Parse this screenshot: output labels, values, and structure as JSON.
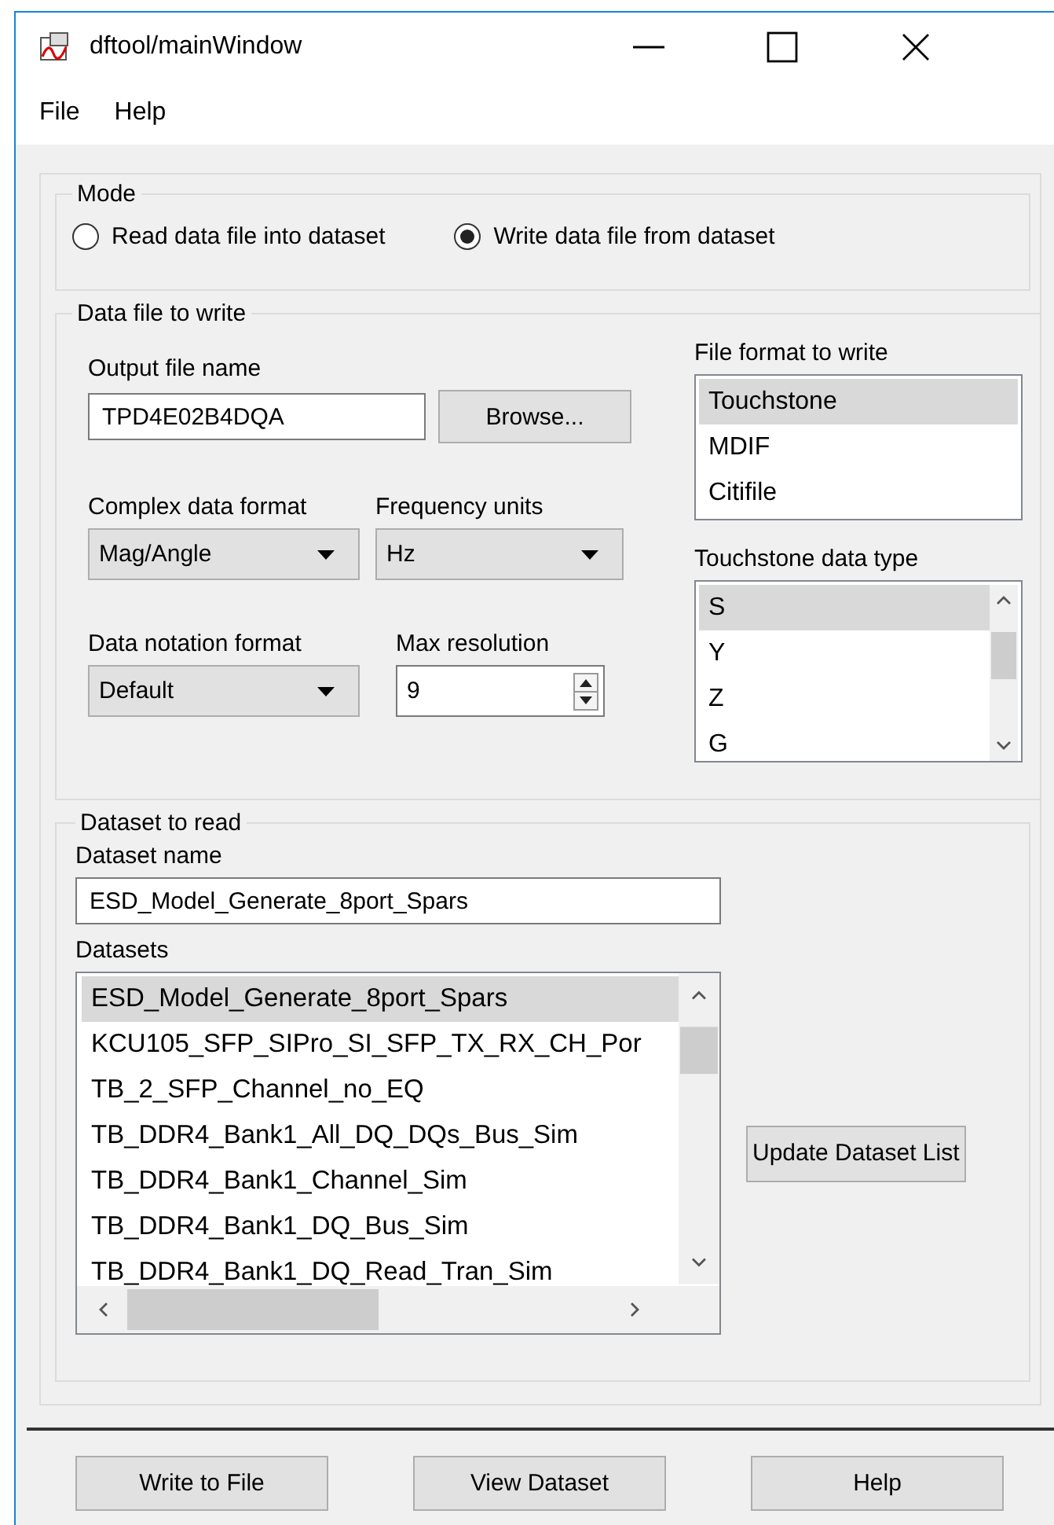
{
  "window": {
    "title": "dftool/mainWindow"
  },
  "menu": [
    {
      "label": "File"
    },
    {
      "label": "Help"
    }
  ],
  "mode": {
    "title": "Mode",
    "options": [
      {
        "label": "Read data file into dataset",
        "selected": false
      },
      {
        "label": "Write data file from dataset",
        "selected": true
      }
    ]
  },
  "data_file": {
    "title": "Data file to write",
    "output_file_name": {
      "label": "Output file name",
      "value": "TPD4E02B4DQA"
    },
    "browse_button": "Browse...",
    "complex_format": {
      "label": "Complex data format",
      "value": "Mag/Angle"
    },
    "frequency_units": {
      "label": "Frequency units",
      "value": "Hz"
    },
    "notation_format": {
      "label": "Data notation format",
      "value": "Default"
    },
    "max_resolution": {
      "label": "Max resolution",
      "value": "9"
    },
    "file_format": {
      "label": "File format to write",
      "items": [
        {
          "label": "Touchstone",
          "selected": true
        },
        {
          "label": "MDIF",
          "selected": false
        },
        {
          "label": "Citifile",
          "selected": false
        }
      ]
    },
    "touchstone_type": {
      "label": "Touchstone data type",
      "items": [
        {
          "label": "S",
          "selected": true
        },
        {
          "label": "Y",
          "selected": false
        },
        {
          "label": "Z",
          "selected": false
        },
        {
          "label": "G",
          "selected": false
        }
      ]
    }
  },
  "dataset": {
    "title": "Dataset to read",
    "name": {
      "label": "Dataset name",
      "value": "ESD_Model_Generate_8port_Spars"
    },
    "datasets": {
      "label": "Datasets",
      "items": [
        {
          "label": "ESD_Model_Generate_8port_Spars",
          "selected": true
        },
        {
          "label": "KCU105_SFP_SIPro_SI_SFP_TX_RX_CH_Por",
          "selected": false
        },
        {
          "label": "TB_2_SFP_Channel_no_EQ",
          "selected": false
        },
        {
          "label": "TB_DDR4_Bank1_All_DQ_DQs_Bus_Sim",
          "selected": false
        },
        {
          "label": "TB_DDR4_Bank1_Channel_Sim",
          "selected": false
        },
        {
          "label": "TB_DDR4_Bank1_DQ_Bus_Sim",
          "selected": false
        },
        {
          "label": "TB_DDR4_Bank1_DQ_Read_Tran_Sim",
          "selected": false
        }
      ]
    },
    "update_button": "Update Dataset List"
  },
  "buttons": [
    "Write to File",
    "View Dataset",
    "Help"
  ]
}
